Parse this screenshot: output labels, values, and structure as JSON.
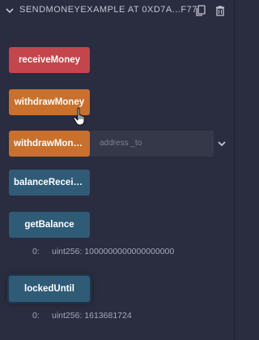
{
  "header": {
    "title": "SENDMONEYEXAMPLE AT 0XD7A...F77",
    "icons": [
      "chevron-down-icon",
      "copy-icon",
      "delete-icon"
    ]
  },
  "functions": [
    {
      "label": "receiveMoney",
      "color": "#c4454b"
    },
    {
      "label": "withdrawMoney",
      "color": "#c9702c"
    },
    {
      "label": "withdrawMoneyTo",
      "color": "#c9702c",
      "input_placeholder": "address _to"
    },
    {
      "label": "balanceReceived",
      "color": "#2f5b77"
    },
    {
      "label": "getBalance",
      "color": "#2f5b77"
    },
    {
      "label": "lockedUntil",
      "color": "#2f5b77"
    }
  ],
  "results": {
    "getBalance": {
      "index": "0:",
      "value": "uint256: 1000000000000000000"
    },
    "lockedUntil": {
      "index": "0:",
      "value": "uint256: 1613681724"
    }
  }
}
